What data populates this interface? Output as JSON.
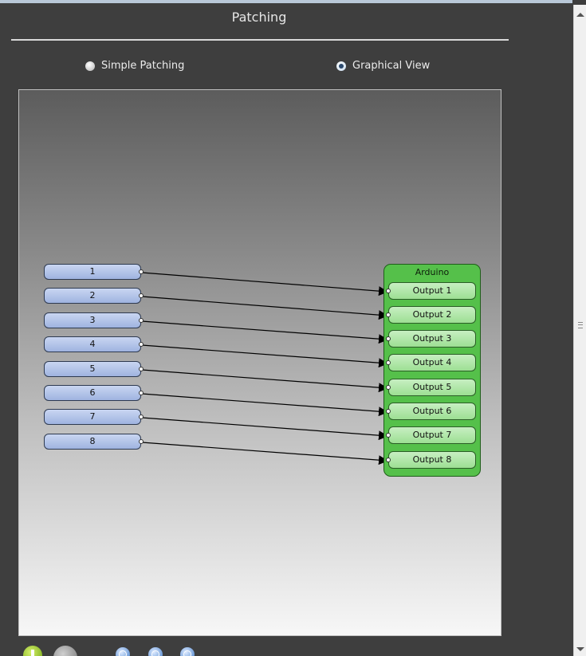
{
  "header": {
    "title": "Patching"
  },
  "view_mode": {
    "options": [
      {
        "label": "Simple Patching",
        "selected": false
      },
      {
        "label": "Graphical View",
        "selected": true
      }
    ]
  },
  "graph": {
    "inputs": [
      {
        "label": "1"
      },
      {
        "label": "2"
      },
      {
        "label": "3"
      },
      {
        "label": "4"
      },
      {
        "label": "5"
      },
      {
        "label": "6"
      },
      {
        "label": "7"
      },
      {
        "label": "8"
      }
    ],
    "device": {
      "name": "Arduino",
      "outputs": [
        {
          "label": "Output 1"
        },
        {
          "label": "Output 2"
        },
        {
          "label": "Output 3"
        },
        {
          "label": "Output 4"
        },
        {
          "label": "Output 5"
        },
        {
          "label": "Output 6"
        },
        {
          "label": "Output 7"
        },
        {
          "label": "Output 8"
        }
      ]
    },
    "connections": [
      {
        "from": "1",
        "to": "Output 1"
      },
      {
        "from": "2",
        "to": "Output 2"
      },
      {
        "from": "3",
        "to": "Output 3"
      },
      {
        "from": "4",
        "to": "Output 4"
      },
      {
        "from": "5",
        "to": "Output 5"
      },
      {
        "from": "6",
        "to": "Output 6"
      },
      {
        "from": "7",
        "to": "Output 7"
      },
      {
        "from": "8",
        "to": "Output 8"
      }
    ]
  },
  "toolbar": {
    "icons": [
      "add-icon",
      "remove-icon",
      "zoom-in-icon",
      "zoom-out-icon",
      "zoom-fit-icon"
    ]
  },
  "colors": {
    "input_node": "#a9bde6",
    "device": "#55c04a",
    "output_node": "#b6e8ae",
    "background_top": "#5c5c5c",
    "background_bottom": "#f7f7f7"
  }
}
